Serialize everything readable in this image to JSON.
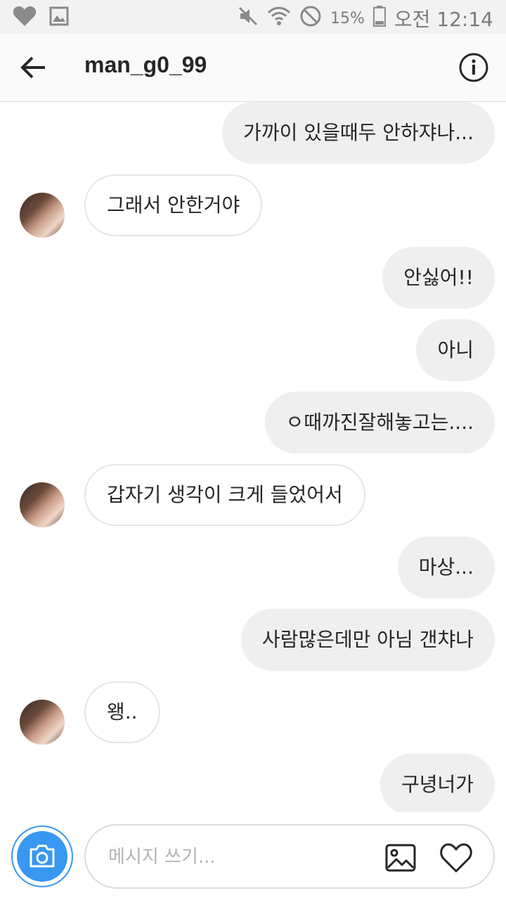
{
  "status_bar": {
    "battery_percent": "15%",
    "time": "오전 12:14",
    "left_icons": [
      "heart-icon",
      "image-icon"
    ],
    "right_icons": [
      "mute-icon",
      "wifi-icon",
      "do-not-disturb-icon",
      "battery-icon"
    ]
  },
  "header": {
    "back_icon": "arrow-left-icon",
    "username": "man_g0_99",
    "info_icon": "info-icon"
  },
  "messages": [
    {
      "sender": "me",
      "text": "가까이 있을때두 안하쟈나..."
    },
    {
      "sender": "them",
      "text": "그래서 안한거야"
    },
    {
      "sender": "me",
      "text": "안싫어!!"
    },
    {
      "sender": "me",
      "text": "아니"
    },
    {
      "sender": "me",
      "text": "ㅇ때까진잘해놓고는...."
    },
    {
      "sender": "them",
      "text": "갑자기 생각이 크게 들었어서"
    },
    {
      "sender": "me",
      "text": "마상..."
    },
    {
      "sender": "me",
      "text": "사람많은데만 아님 갠챠나"
    },
    {
      "sender": "them",
      "text": "왱.."
    },
    {
      "sender": "me",
      "text": "구녕너가"
    }
  ],
  "composer": {
    "camera_icon": "camera-icon",
    "placeholder": "메시지 쓰기...",
    "gallery_icon": "gallery-icon",
    "like_icon": "heart-icon"
  },
  "colors": {
    "accent": "#3897f0",
    "my_bubble": "#efefef",
    "their_bubble_border": "#e6e6e6"
  }
}
